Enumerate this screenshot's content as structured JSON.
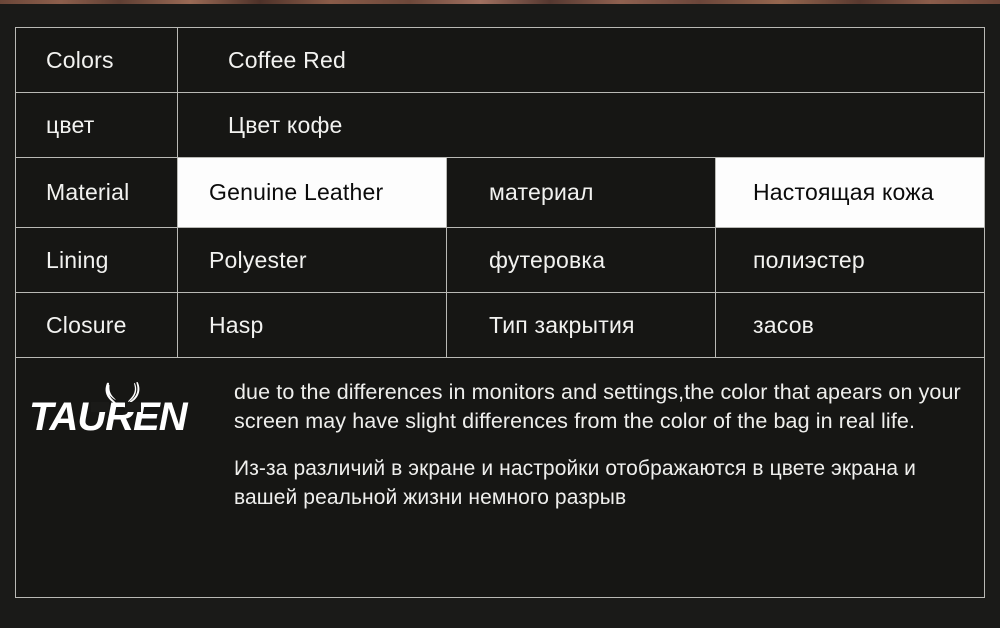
{
  "page": {
    "background_color": "#1a1a18",
    "table_border_color": "#b9b9b5",
    "cell_dark_color": "#161614",
    "cell_light_color": "#fdfdfd",
    "text_light_color": "#f2f2f0",
    "text_dark_color": "#0b0b0b"
  },
  "spec_table": {
    "rows": [
      {
        "label": "Colors",
        "value_en": "Coffee    Red",
        "label_ru": "",
        "value_ru": "",
        "span": true,
        "highlight": false
      },
      {
        "label": "цвет",
        "value_en": "Цвет кофе",
        "label_ru": "",
        "value_ru": "",
        "span": true,
        "highlight": false
      },
      {
        "label": "Material",
        "value_en": "Genuine Leather",
        "label_ru": "материал",
        "value_ru": "Настоящая кожа",
        "span": false,
        "highlight": true
      },
      {
        "label": "Lining",
        "value_en": "Polyester",
        "label_ru": "футеровка",
        "value_ru": "полиэстер",
        "span": false,
        "highlight": false
      },
      {
        "label": "Closure",
        "value_en": "Hasp",
        "label_ru": "Тип закрытия",
        "value_ru": "засов",
        "span": false,
        "highlight": false
      }
    ]
  },
  "footer": {
    "brand_name": "TAUREN",
    "disclaimer_en": "due to the differences in monitors and settings,the color that apears on your screen may have slight differences from the color of the bag in real life.",
    "disclaimer_ru": "Из-за различий в экране и настройки отображаются в цвете экрана и вашей реальной жизни немного разрыв"
  }
}
